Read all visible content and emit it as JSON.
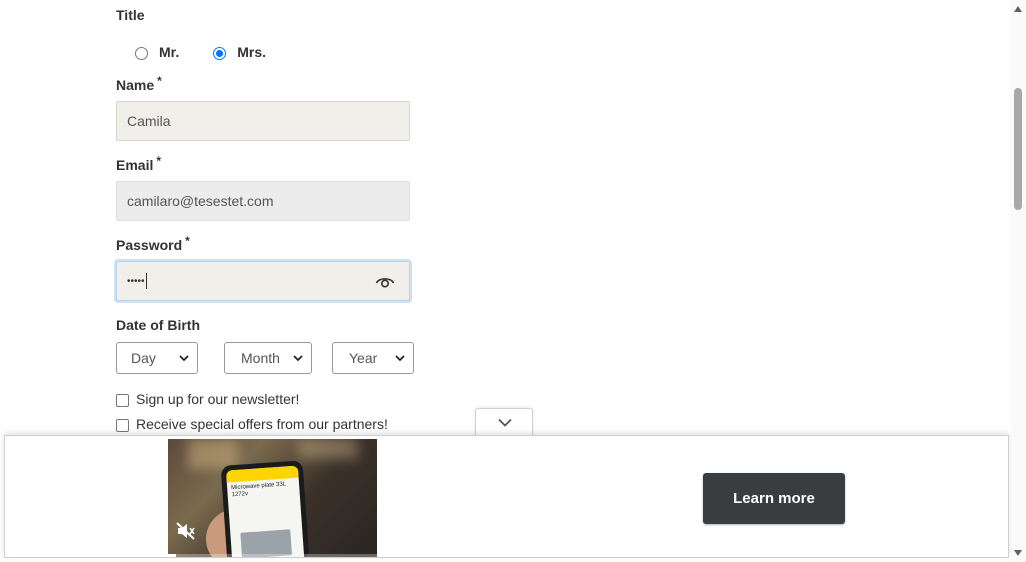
{
  "form": {
    "title_label": "Title",
    "title_options": [
      {
        "label": "Mr.",
        "checked": false
      },
      {
        "label": "Mrs.",
        "checked": true
      }
    ],
    "name_label": "Name",
    "name_value": "Camila",
    "email_label": "Email",
    "email_value": "camilaro@tesestet.com",
    "password_label": "Password",
    "password_masked": "•••••",
    "required_marker": "*",
    "dob_label": "Date of Birth",
    "dob_day": "Day",
    "dob_month": "Month",
    "dob_year": "Year",
    "newsletter_label": "Sign up for our newsletter!",
    "partners_label": "Receive special offers from our partners!"
  },
  "ad": {
    "cta_label": "Learn more",
    "video_text": "Microwave plate 33L 1272v",
    "video_progress": 0.04
  },
  "colors": {
    "accent": "#0075ff",
    "field_bg": "#f0efe9",
    "button_bg": "#3a3d40"
  },
  "icons": [
    "eye-icon",
    "chevron-down-icon",
    "mute-icon"
  ]
}
